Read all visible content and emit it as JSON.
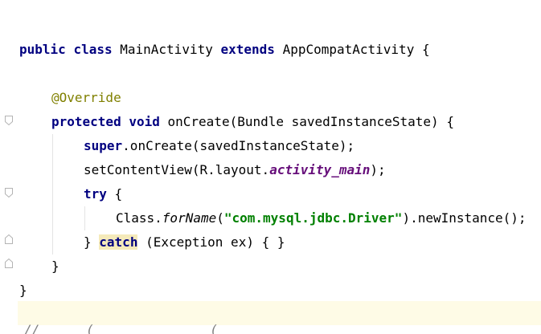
{
  "code": {
    "line1": {
      "kw_public": "public",
      "kw_class": "class",
      "class_name": "MainActivity",
      "kw_extends": "extends",
      "super_class": "AppCompatActivity",
      "brace": "{"
    },
    "line2": {
      "annotation": "@Override"
    },
    "line3": {
      "kw_protected": "protected",
      "kw_void": "void",
      "method": "onCreate(Bundle savedInstanceState)",
      "brace": "{"
    },
    "line4": {
      "kw_super": "super",
      "rest": ".onCreate(savedInstanceState);"
    },
    "line5": {
      "prefix": "setContentView(R.layout.",
      "field": "activity_main",
      "suffix": ");"
    },
    "line6": {
      "kw_try": "try",
      "brace": "{"
    },
    "line7": {
      "prefix": "Class.",
      "method": "forName",
      "paren_open": "(",
      "string": "\"com.mysql.jdbc.Driver\"",
      "suffix": ").newInstance();"
    },
    "line8": {
      "close": "}",
      "kw_catch": "catch",
      "rest": "(Exception ex) { }"
    },
    "line9": {
      "close": "}"
    },
    "line10": {
      "close": "}"
    },
    "cutoff": "//      (               ("
  },
  "colors": {
    "keyword": "#000080",
    "annotation": "#808000",
    "field": "#660e7a",
    "string": "#008000",
    "current_line": "#fefbe6",
    "catch_highlight": "#f5eaba"
  },
  "icons": {
    "fold_open": "fold-open-icon",
    "fold_close": "fold-close-icon"
  }
}
